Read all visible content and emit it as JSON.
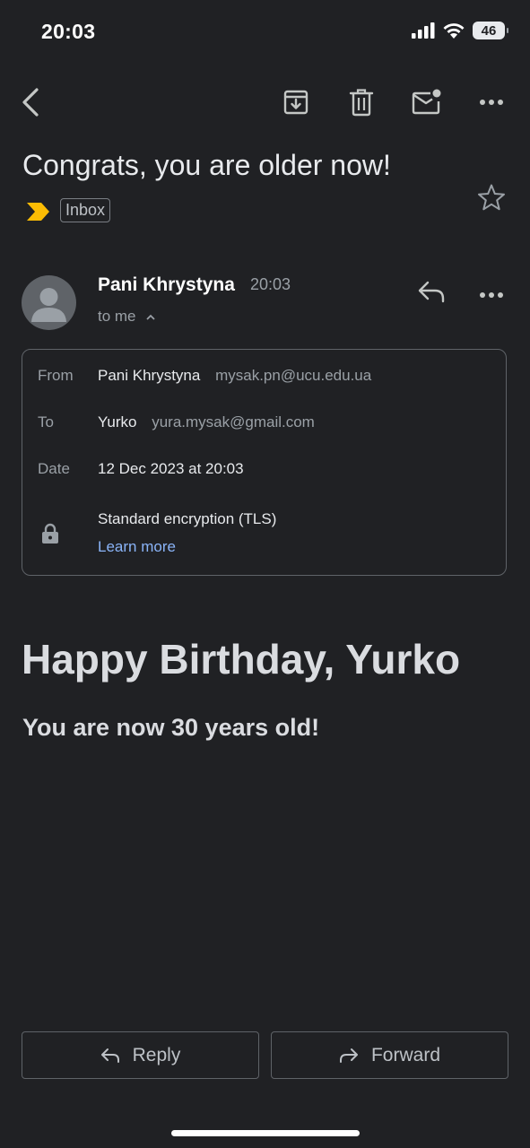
{
  "status_bar": {
    "time": "20:03",
    "battery": "46"
  },
  "toolbar": {
    "icons": [
      "back-icon",
      "archive-icon",
      "trash-icon",
      "mark-unread-icon",
      "more-icon"
    ]
  },
  "email": {
    "subject": "Congrats, you are older now!",
    "label": "Inbox",
    "sender_name": "Pani Khrystyna",
    "sent_time": "20:03",
    "recipient_summary": "to me"
  },
  "details": {
    "from_label": "From",
    "from_name": "Pani Khrystyna",
    "from_email": "mysak.pn@ucu.edu.ua",
    "to_label": "To",
    "to_name": "Yurko",
    "to_email": "yura.mysak@gmail.com",
    "date_label": "Date",
    "date_value": "12 Dec 2023 at 20:03",
    "encryption": "Standard encryption (TLS)",
    "learn_more": "Learn more"
  },
  "body": {
    "heading": "Happy Birthday, Yurko",
    "subheading": "You are now 30 years old!"
  },
  "actions": {
    "reply_label": "Reply",
    "forward_label": "Forward"
  },
  "colors": {
    "background": "#202124",
    "link": "#8ab4f8",
    "importance": "#fbbc04"
  }
}
